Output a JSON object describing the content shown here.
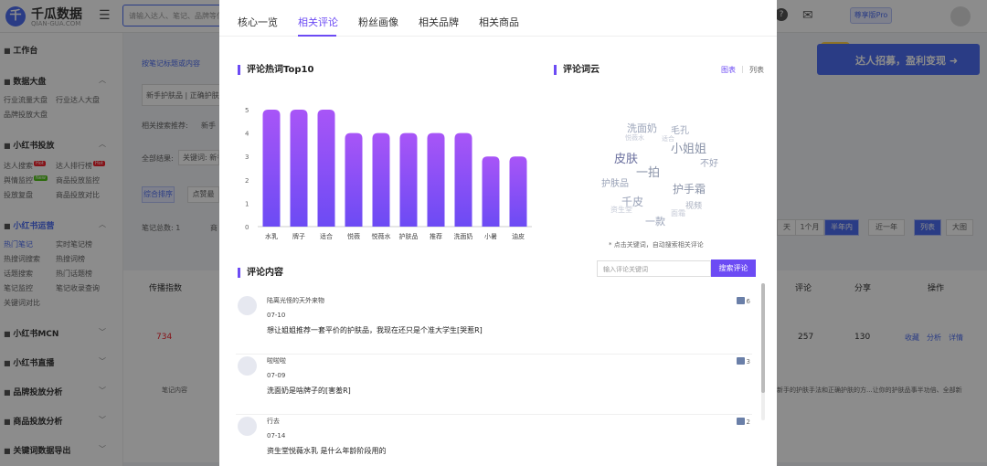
{
  "app": {
    "logo_mark": "千",
    "logo_text": "千瓜数据",
    "logo_sub": "QIAN-GUA.COM",
    "search_placeholder": "请输入达人、笔记、品牌等信息",
    "help_label": "?",
    "version_badge": "尊享版Pro",
    "banner": "达人招募，盈利变现"
  },
  "sidebar": {
    "workbench": "工作台",
    "data_board": "数据大盘",
    "board_items": [
      "行业流量大盘",
      "行业达人大盘",
      "品牌投放大盘"
    ],
    "xhs_ad": "小红书投放",
    "ad_items": [
      "达人搜索",
      "达人排行榜",
      "舆情监控",
      "商品投放监控",
      "投放复盘",
      "商品投放对比"
    ],
    "xhs_ops": "小红书运营",
    "ops_items": [
      "热门笔记",
      "实时笔记榜",
      "热搜词搜索",
      "热搜词榜",
      "话题搜索",
      "热门话题榜",
      "笔记监控",
      "笔记收录查询",
      "关键词对比"
    ],
    "hot_tag": "Hot",
    "new_tag": "New",
    "mcn": "小红书MCN",
    "live": "小红书直播",
    "brand": "品牌投放分析",
    "goods": "商品投放分析",
    "keywords": "关键词数据导出"
  },
  "background": {
    "note_title": "按笔记标题或内容",
    "tags_input": "新手护肤品 | 正确护肤",
    "related_label": "相关搜索推荐:",
    "related_value": "新手",
    "filter_label": "全部结果:",
    "filter_value": "关键词: 新手",
    "sort_active": "综合排序",
    "sort_2": "点赞最",
    "total": "笔记总数: 1",
    "total_b": "商",
    "range_1": "1个月",
    "range_2": "半年内",
    "range_3": "近一年",
    "range_prev": "天",
    "view_list": "列表",
    "view_grid": "大图",
    "col_spread": "传播指数",
    "col_comment": "评论",
    "col_share": "分享",
    "col_action": "操作",
    "row_spread": "734",
    "row_comment": "257",
    "row_share": "130",
    "action_collect": "收藏",
    "action_analyze": "分析",
    "action_detail": "详情",
    "note_content_label": "笔记内容",
    "note_snippet": "新手的护肤手法和正确护肤的方...让你的护肤品事半功倍、全部新"
  },
  "modal": {
    "tabs": [
      "核心一览",
      "相关评论",
      "粉丝画像",
      "相关品牌",
      "相关商品"
    ],
    "active_tab": 1,
    "top10_title": "评论热词Top10",
    "cloud_title": "评论词云",
    "view_chart": "图表",
    "view_sep": "|",
    "view_list": "列表",
    "cloud_note": "* 点击关键词，自动搜索相关评论",
    "comments_title": "评论内容",
    "comment_search_placeholder": "输入评论关键词",
    "comment_search_button": "搜索评论",
    "comments": [
      {
        "user": "陆离光怪的天外来物",
        "date": "07-10",
        "text": "想让姐姐推荐一套平价的护肤品，我现在还只是个准大学生[哭惹R]",
        "likes": "6"
      },
      {
        "user": "啦啦啦",
        "date": "07-09",
        "text": "洗面奶是啥牌子的[害羞R]",
        "likes": "3"
      },
      {
        "user": "行去",
        "date": "07-14",
        "text": "资生堂悦薇水乳 是什么年龄阶段用的",
        "likes": "2"
      }
    ]
  },
  "word_cloud": [
    {
      "text": "洗面奶",
      "size": 11,
      "color": "#9aa3b8"
    },
    {
      "text": "毛孔",
      "size": 10,
      "color": "#9aa3b8"
    },
    {
      "text": "悦薇水",
      "size": 7,
      "color": "#c4c9d6"
    },
    {
      "text": "适合",
      "size": 7,
      "color": "#c4c9d6"
    },
    {
      "text": "小姐姐",
      "size": 13,
      "color": "#8a93a8"
    },
    {
      "text": "皮肤",
      "size": 13,
      "color": "#6a6f9e"
    },
    {
      "text": "不好",
      "size": 10,
      "color": "#9aa3b8"
    },
    {
      "text": "一拍",
      "size": 13,
      "color": "#8a93a8"
    },
    {
      "text": "护肤品",
      "size": 10,
      "color": "#9aa3b8"
    },
    {
      "text": "护手霜",
      "size": 12,
      "color": "#8a93a8"
    },
    {
      "text": "千皮",
      "size": 12,
      "color": "#9aa3b8"
    },
    {
      "text": "视频",
      "size": 9,
      "color": "#aab0c0"
    },
    {
      "text": "资生堂",
      "size": 8,
      "color": "#c4c9d6"
    },
    {
      "text": "面霜",
      "size": 8,
      "color": "#c4c9d6"
    },
    {
      "text": "一款",
      "size": 11,
      "color": "#9aa3b8"
    }
  ],
  "chart_data": {
    "type": "bar",
    "title": "评论热词Top10",
    "categories": [
      "水乳",
      "牌子",
      "适合",
      "悦薇",
      "悦薇水",
      "护肤品",
      "推荐",
      "洗面奶",
      "小暑",
      "油皮"
    ],
    "values": [
      5,
      5,
      5,
      4,
      4,
      4,
      4,
      4,
      3,
      3
    ],
    "ylim": [
      0,
      5
    ],
    "yticks": [
      0,
      1,
      2,
      3,
      4,
      5
    ],
    "grid": false,
    "bar_color_top": "#a855f7",
    "bar_color_bottom": "#6c4bf4"
  }
}
